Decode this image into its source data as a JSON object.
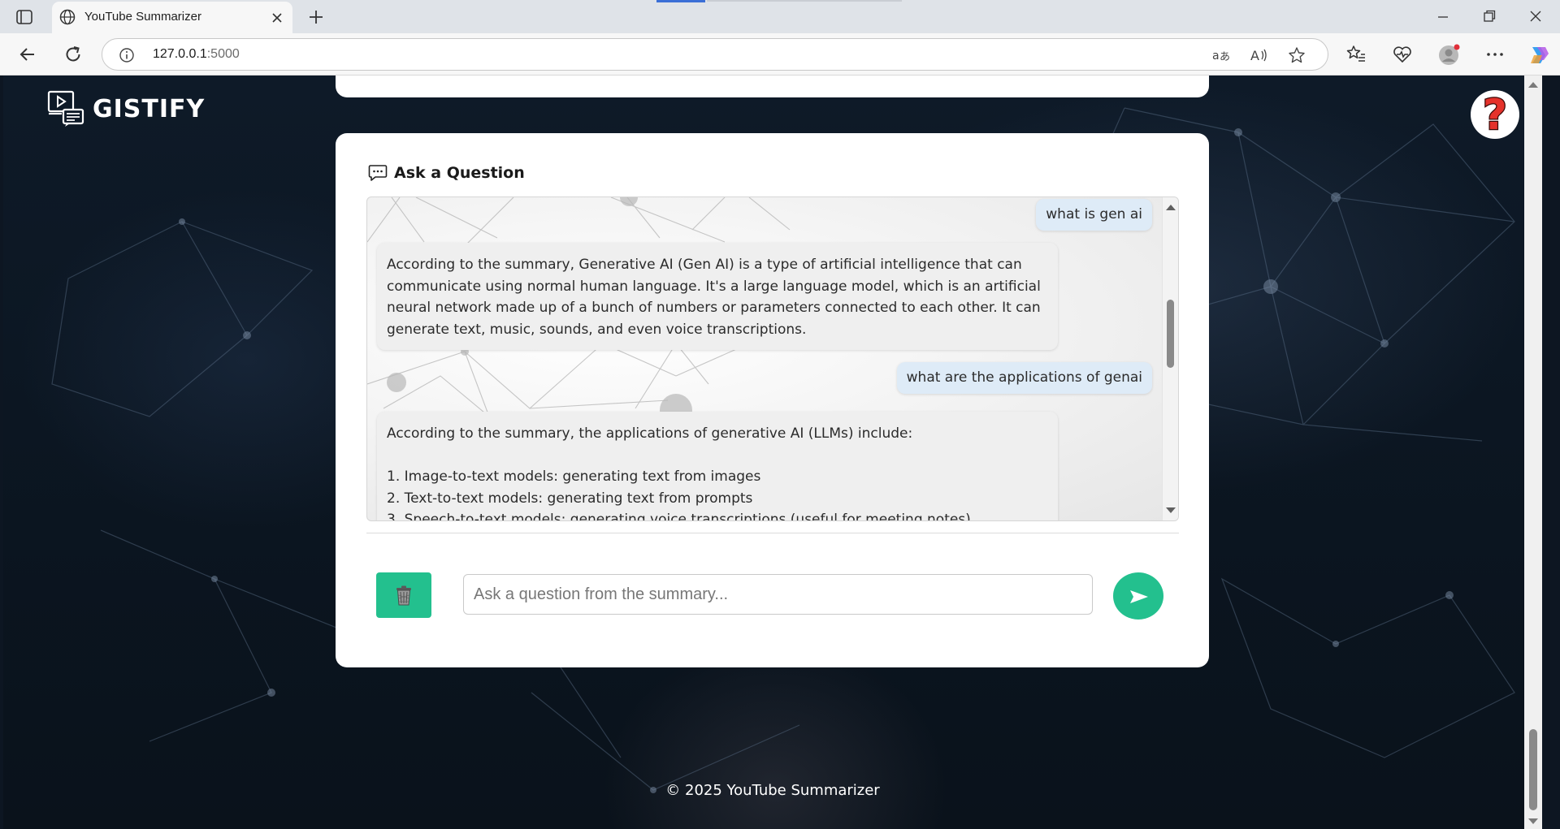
{
  "browser": {
    "tab": {
      "title": "YouTube Summarizer"
    },
    "address": {
      "host": "127.0.0.1",
      "port": ":5000"
    }
  },
  "app": {
    "logo_text": "GISTIFY"
  },
  "qa": {
    "title": "Ask a Question",
    "messages": [
      {
        "role": "user",
        "text": "what is gen ai"
      },
      {
        "role": "bot",
        "text": "According to the summary, Generative AI (Gen AI) is a type of artificial intelligence that can\ncommunicate using normal human language. It's a large language model, which is an artificial\nneural network made up of a bunch of numbers or parameters connected to each other. It can\ngenerate text, music, sounds, and even voice transcriptions."
      },
      {
        "role": "user",
        "text": "what are the applications of genai"
      },
      {
        "role": "bot",
        "text": "According to the summary, the applications of generative AI (LLMs) include:\n\n1. Image-to-text models: generating text from images\n2. Text-to-text models: generating text from prompts\n3. Speech-to-text models: generating voice transcriptions (useful for meeting notes)"
      }
    ],
    "input_placeholder": "Ask a question from the summary..."
  },
  "footer": {
    "text": "© 2025 YouTube Summarizer"
  },
  "colors": {
    "accent": "#23c08e",
    "user_bubble": "#deebf7",
    "bot_bubble": "#efefef",
    "page_bg": "#0d1622"
  },
  "icons": [
    "tab-actions-icon",
    "globe-icon",
    "close-icon",
    "plus-icon",
    "back-icon",
    "refresh-icon",
    "info-icon",
    "translate-icon",
    "read-aloud-icon",
    "star-icon",
    "favorites-icon",
    "health-icon",
    "profile-icon",
    "more-icon",
    "copilot-icon",
    "logo-icon",
    "help-icon",
    "chat-icon",
    "trash-icon",
    "send-icon"
  ]
}
